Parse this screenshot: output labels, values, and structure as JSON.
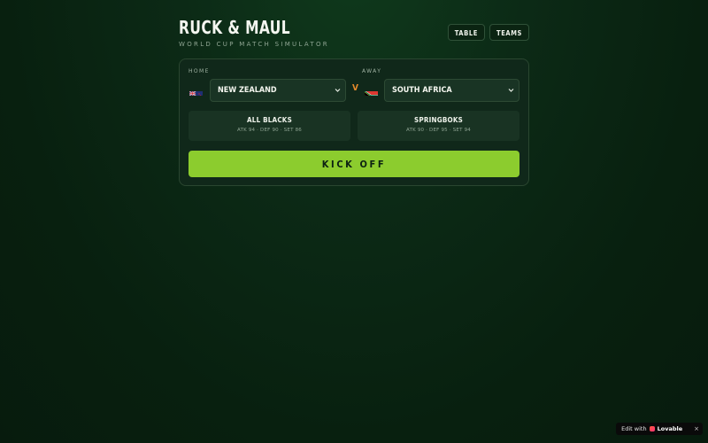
{
  "app": {
    "title": "RUCK & MAUL",
    "subtitle": "WORLD CUP MATCH SIMULATOR"
  },
  "nav": {
    "table_label": "TABLE",
    "teams_label": "TEAMS"
  },
  "match": {
    "home": {
      "label": "HOME",
      "team": "NEW ZEALAND",
      "flag_icon": "new-zealand-flag-icon",
      "nickname": "ALL BLACKS",
      "stats": "ATK 94 · DEF 90 · SET 86"
    },
    "vs_label": "V",
    "away": {
      "label": "AWAY",
      "team": "SOUTH AFRICA",
      "flag_icon": "south-africa-flag-icon",
      "nickname": "SPRINGBOKS",
      "stats": "ATK 90 · DEF 95 · SET 94"
    },
    "kickoff_label": "KICK OFF"
  },
  "badge": {
    "prefix": "Edit with",
    "brand": "Lovable",
    "close": "×"
  },
  "colors": {
    "accent": "#8ccc2e",
    "versus": "#e58a2b",
    "background": "#0c2a16"
  }
}
